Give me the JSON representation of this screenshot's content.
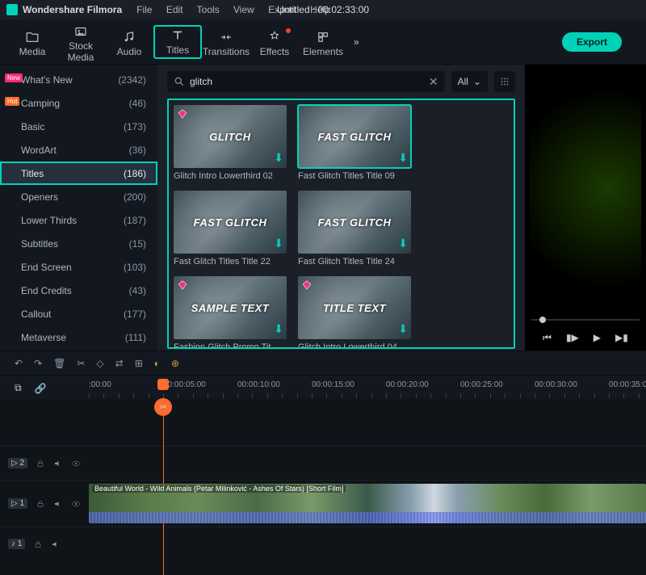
{
  "app": {
    "name": "Wondershare Filmora",
    "project_title": "Untitled : 00:02:33:00"
  },
  "menubar": [
    "File",
    "Edit",
    "Tools",
    "View",
    "Export",
    "Help"
  ],
  "toolbar": {
    "items": [
      {
        "id": "media",
        "label": "Media"
      },
      {
        "id": "stock",
        "label": "Stock Media"
      },
      {
        "id": "audio",
        "label": "Audio"
      },
      {
        "id": "titles",
        "label": "Titles"
      },
      {
        "id": "transitions",
        "label": "Transitions"
      },
      {
        "id": "effects",
        "label": "Effects"
      },
      {
        "id": "elements",
        "label": "Elements"
      }
    ],
    "export_label": "Export"
  },
  "sidebar": {
    "items": [
      {
        "label": "What's New",
        "count": "(2342)",
        "tag": "New"
      },
      {
        "label": "Camping",
        "count": "(46)",
        "tag": "Hot"
      },
      {
        "label": "Basic",
        "count": "(173)"
      },
      {
        "label": "WordArt",
        "count": "(36)"
      },
      {
        "label": "Titles",
        "count": "(186)",
        "selected": true
      },
      {
        "label": "Openers",
        "count": "(200)"
      },
      {
        "label": "Lower Thirds",
        "count": "(187)"
      },
      {
        "label": "Subtitles",
        "count": "(15)"
      },
      {
        "label": "End Screen",
        "count": "(103)"
      },
      {
        "label": "End Credits",
        "count": "(43)"
      },
      {
        "label": "Callout",
        "count": "(177)"
      },
      {
        "label": "Metaverse",
        "count": "(111)"
      }
    ]
  },
  "search": {
    "value": "glitch",
    "filter": "All"
  },
  "results": [
    {
      "title": "Glitch Intro Lowerthird 02",
      "overlay": "GLITCH",
      "premium": true,
      "selected": false
    },
    {
      "title": "Fast Glitch Titles Title 09",
      "overlay": "FAST GLITCH",
      "premium": false,
      "selected": true
    },
    {
      "title": "Fast Glitch Titles Title 22",
      "overlay": "FAST GLITCH",
      "premium": false,
      "selected": false
    },
    {
      "title": "Fast Glitch Titles Title 24",
      "overlay": "FAST GLITCH",
      "premium": false,
      "selected": false
    },
    {
      "title": "Fashion Glitch Promo Tit…",
      "overlay": "SAMPLE TEXT",
      "premium": true,
      "selected": false
    },
    {
      "title": "Glitch Intro Lowerthird 04",
      "overlay": "TITLE TEXT",
      "premium": true,
      "selected": false
    }
  ],
  "timeline": {
    "ticks": [
      ":00:00",
      "00:00:05:00",
      "00:00:10:00",
      "00:00:15:00",
      "00:00:20:00",
      "00:00:25:00",
      "00:00:30:00",
      "00:00:35:00"
    ],
    "playhead_tick_index": 1,
    "tracks": [
      {
        "id": "v2",
        "label": "▷ 2",
        "kind": "video"
      },
      {
        "id": "v1",
        "label": "▷ 1",
        "kind": "video-main",
        "clip_title": "Beautiful World - Wild Animals (Petar Milinković - Ashes Of Stars) [Short Film]"
      },
      {
        "id": "a1",
        "label": "♪ 1",
        "kind": "audio"
      }
    ]
  }
}
